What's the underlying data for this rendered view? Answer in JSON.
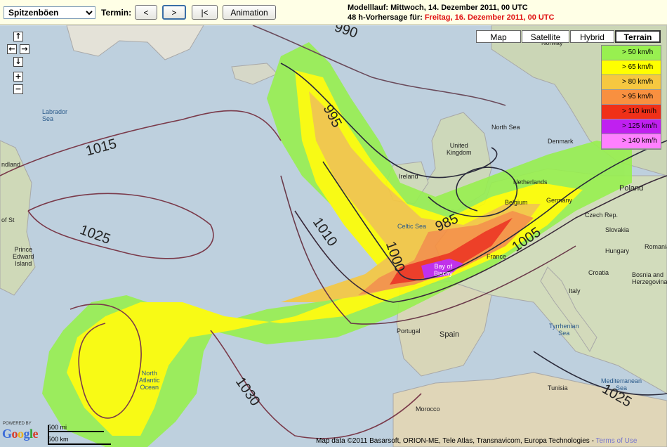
{
  "toolbar": {
    "product_selected": "Spitzenböen",
    "termin_label": "Termin:",
    "prev_label": "<",
    "next_label": ">",
    "first_label": "|<",
    "animation_label": "Animation",
    "run_label": "Modelllauf: Mittwoch, 14. Dezember 2011, 00 UTC",
    "forecast_prefix": "48 h-Vorhersage für: ",
    "forecast_date": "Freitag, 16. Dezember 2011, 00 UTC"
  },
  "map_types": [
    "Map",
    "Satellite",
    "Hybrid",
    "Terrain"
  ],
  "map_type_active": "Terrain",
  "legend": [
    {
      "label": "> 50 km/h",
      "color": "#98f050"
    },
    {
      "label": "> 65 km/h",
      "color": "#ffff00"
    },
    {
      "label": "> 80 km/h",
      "color": "#f6c840"
    },
    {
      "label": "> 95 km/h",
      "color": "#f89040"
    },
    {
      "label": "> 110 km/h",
      "color": "#f03018"
    },
    {
      "label": "> 125 km/h",
      "color": "#c020f0"
    },
    {
      "label": "> 140 km/h",
      "color": "#ff80ff"
    }
  ],
  "nav": {
    "up": "↑",
    "left": "←",
    "right": "→",
    "down": "↓",
    "zoom_in": "+",
    "zoom_out": "−"
  },
  "isobars": [
    {
      "text": "990"
    },
    {
      "text": "995"
    },
    {
      "text": "1015"
    },
    {
      "text": "1025"
    },
    {
      "text": "1010"
    },
    {
      "text": "1000"
    },
    {
      "text": "985"
    },
    {
      "text": "1005"
    },
    {
      "text": "1030"
    },
    {
      "text": "1025"
    }
  ],
  "places": {
    "norway": "Norway",
    "labrador_sea": "Labrador\nSea",
    "north_sea": "North Sea",
    "uk": "United\nKingdom",
    "denmark": "Denmark",
    "ireland": "Ireland",
    "netherlands": "Netherlands",
    "belgium": "Belgium",
    "germany": "Germany",
    "poland": "Poland",
    "celtic_sea": "Celtic Sea",
    "czech": "Czech Rep.",
    "slovakia": "Slovakia",
    "hungary": "Hungary",
    "romania": "Romania",
    "croatia": "Croatia",
    "bosnia": "Bosnia and\nHerzegovina",
    "france": "France",
    "bay_biscay": "Bay of\nBiscay",
    "italy": "Italy",
    "portugal": "Portugal",
    "spain": "Spain",
    "tyrrhenian": "Tyrrhenian\nSea",
    "tunisia": "Tunisia",
    "morocco": "Morocco",
    "mediterranean": "Mediterranean\nSea",
    "north_atlantic": "North\nAtlantic\nOcean",
    "newfoundland": "ndland",
    "st": "of St",
    "pei": "Prince\nEdward\nIsland"
  },
  "footer": {
    "scale_mi": "500 mi",
    "scale_km": "500 km",
    "powered_by": "POWERED BY",
    "google": "Google",
    "copyright": "Map data ©2011 Basarsoft, ORION-ME, Tele Atlas, Transnavicom, Europa Technologies - ",
    "terms": "Terms of Use"
  }
}
